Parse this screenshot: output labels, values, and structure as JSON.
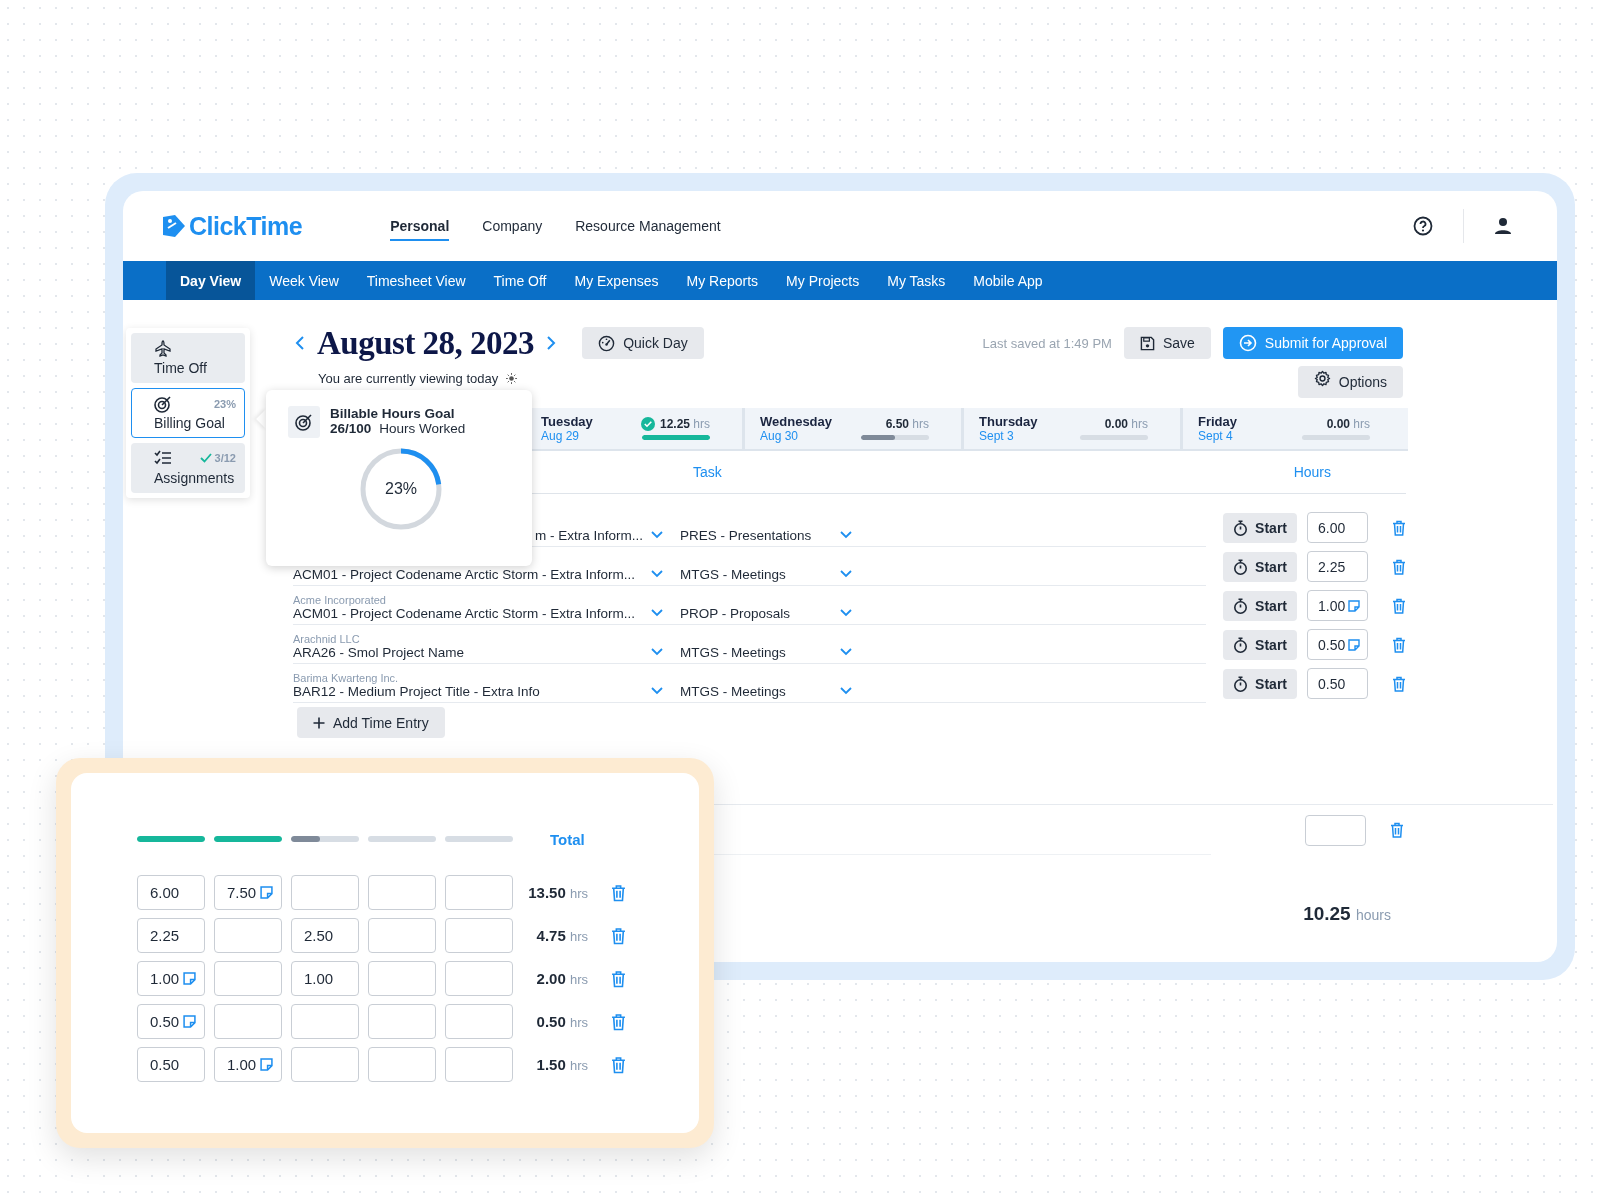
{
  "logo": {
    "text": "ClickTime"
  },
  "top_tabs": [
    {
      "label": "Personal",
      "selected": true
    },
    {
      "label": "Company",
      "selected": false
    },
    {
      "label": "Resource Management",
      "selected": false
    }
  ],
  "nav": [
    {
      "label": "Day View",
      "selected": true
    },
    {
      "label": "Week View",
      "selected": false
    },
    {
      "label": "Timesheet View",
      "selected": false
    },
    {
      "label": "Time Off",
      "selected": false
    },
    {
      "label": "My Expenses",
      "selected": false
    },
    {
      "label": "My Reports",
      "selected": false
    },
    {
      "label": "My Projects",
      "selected": false
    },
    {
      "label": "My Tasks",
      "selected": false
    },
    {
      "label": "Mobile App",
      "selected": false
    }
  ],
  "side_panel": [
    {
      "kind": "time_off",
      "label": "Time Off",
      "selected": false
    },
    {
      "kind": "goal",
      "label": "Billing Goal",
      "badge": "23%",
      "selected": true
    },
    {
      "kind": "assignments",
      "label": "Assignments",
      "badge": "3/12",
      "selected": false
    }
  ],
  "header": {
    "date": "August 28, 2023",
    "subtitle": "You are currently viewing today",
    "quick_day": "Quick Day",
    "last_saved": "Last saved at 1:49 PM",
    "save": "Save",
    "submit": "Submit for Approval",
    "options": "Options"
  },
  "popover": {
    "title": "Billable Hours Goal",
    "count": "26/100",
    "count_label": "Hours Worked",
    "percent": "23%",
    "level": 0.23
  },
  "days": [
    {
      "name": "Tuesday",
      "date": "Aug 29",
      "hours": "12.25",
      "unit": "hrs",
      "level": 1,
      "complete": true
    },
    {
      "name": "Wednesday",
      "date": "Aug 30",
      "hours": "6.50",
      "unit": "hrs",
      "level": 0.5,
      "complete": false
    },
    {
      "name": "Thursday",
      "date": "Sept 3",
      "hours": "0.00",
      "unit": "hrs",
      "level": 0,
      "complete": false
    },
    {
      "name": "Friday",
      "date": "Sept 4",
      "hours": "0.00",
      "unit": "hrs",
      "level": 0,
      "complete": false
    }
  ],
  "columns": {
    "task": "Task",
    "hours": "Hours"
  },
  "entries": [
    {
      "project": "m - Extra Inform...",
      "task": "PRES - Presentations",
      "start": "Start",
      "hours": "6.00",
      "note": false
    },
    {
      "project": "ACM01 - Project Codename Arctic Storm - Extra Inform...",
      "task": "MTGS - Meetings",
      "start": "Start",
      "hours": "2.25",
      "note": false
    },
    {
      "client": "Acme Incorporated",
      "project": "ACM01 - Project Codename Arctic Storm - Extra Inform...",
      "task": "PROP - Proposals",
      "start": "Start",
      "hours": "1.00",
      "note": true
    },
    {
      "client": "Arachnid LLC",
      "project": "ARA26 - Smol Project Name",
      "task": "MTGS - Meetings",
      "start": "Start",
      "hours": "0.50",
      "note": true
    },
    {
      "client": "Barima Kwarteng Inc.",
      "project": "BAR12 - Medium Project Title - Extra Info",
      "task": "MTGS - Meetings",
      "start": "Start",
      "hours": "0.50",
      "note": false
    }
  ],
  "add_entry": "Add Time Entry",
  "total": {
    "value": "10.25",
    "unit": "hours"
  },
  "week_card": {
    "bars": [
      {
        "level": 1,
        "complete": true
      },
      {
        "level": 1,
        "complete": true
      },
      {
        "level": 0.42,
        "complete": false
      },
      {
        "level": 0,
        "complete": false
      },
      {
        "level": 0,
        "complete": false
      }
    ],
    "total_label": "Total",
    "rows": [
      {
        "cells": [
          {
            "value": "6.00",
            "note": false
          },
          {
            "value": "7.50",
            "note": true
          },
          null,
          null,
          null
        ],
        "total": "13.50",
        "unit": "hrs"
      },
      {
        "cells": [
          {
            "value": "2.25",
            "note": false
          },
          null,
          {
            "value": "2.50",
            "note": false
          },
          null,
          null
        ],
        "total": "4.75",
        "unit": "hrs"
      },
      {
        "cells": [
          {
            "value": "1.00",
            "note": true
          },
          null,
          {
            "value": "1.00",
            "note": false
          },
          null,
          null
        ],
        "total": "2.00",
        "unit": "hrs"
      },
      {
        "cells": [
          {
            "value": "0.50",
            "note": true
          },
          null,
          null,
          null,
          null
        ],
        "total": "0.50",
        "unit": "hrs"
      },
      {
        "cells": [
          {
            "value": "0.50",
            "note": false
          },
          {
            "value": "1.00",
            "note": true
          },
          null,
          null,
          null
        ],
        "total": "1.50",
        "unit": "hrs"
      }
    ]
  }
}
